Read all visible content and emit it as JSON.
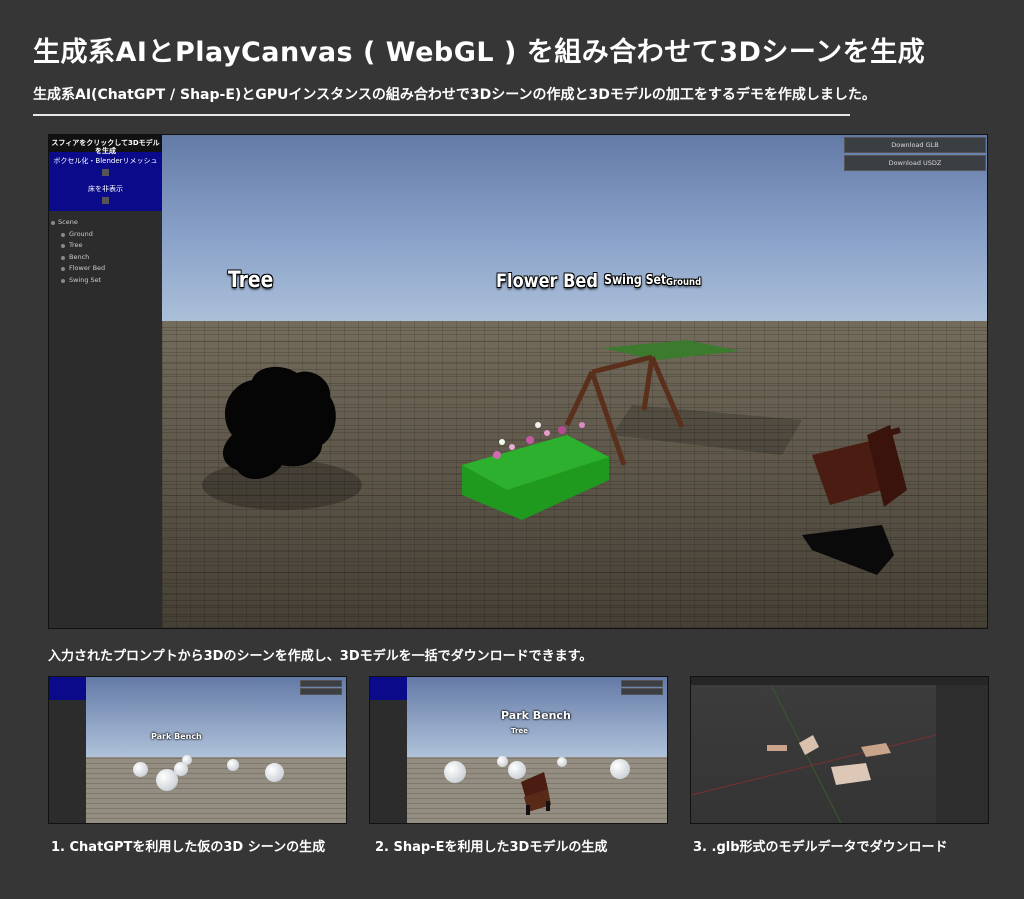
{
  "header": {
    "title": "生成系AIとPlayCanvas ( WebGL ) を組み合わせて3Dシーンを生成",
    "subtitle": "生成系AI(ChatGPT / Shap-E)とGPUインスタンスの組み合わせで3Dシーンの作成と3Dモデルの加工をするデモを作成しました。"
  },
  "viewer": {
    "panel_title": "スフィアをクリックして3Dモデルを生成",
    "option_1": "ボクセル化・Blenderリメッシュ",
    "option_2": "床を非表示",
    "hierarchy": {
      "root": "Scene",
      "children": [
        "Ground",
        "Tree",
        "Bench",
        "Flower Bed",
        "Swing Set"
      ]
    },
    "buttons": {
      "download_glb": "Download GLB",
      "download_usdz": "Download USDZ"
    },
    "labels": {
      "tree": "Tree",
      "flower_bed": "Flower Bed",
      "swing_set": "Swing Set",
      "ground": "Ground"
    }
  },
  "caption_main": "入力されたプロンプトから3Dのシーンを作成し、3Dモデルを一括でダウンロードできます。",
  "thumbnails": [
    {
      "caption": "1. ChatGPTを利用した仮の3D シーンの生成",
      "labels": [
        "Park Bench"
      ]
    },
    {
      "caption": "2. Shap-Eを利用した3Dモデルの生成",
      "labels": [
        "Park Bench",
        "Tree"
      ]
    },
    {
      "caption": "3. .glb形式のモデルデータでダウンロード",
      "labels": []
    }
  ],
  "colors": {
    "page_bg": "#363636",
    "panel_header_blue": "#0a0a8a",
    "sky_top": "#647aa7",
    "sky_bottom": "#b3c6dc",
    "flowerbed_green": "#1f9a1f",
    "bench_wood": "#4a1c12"
  }
}
